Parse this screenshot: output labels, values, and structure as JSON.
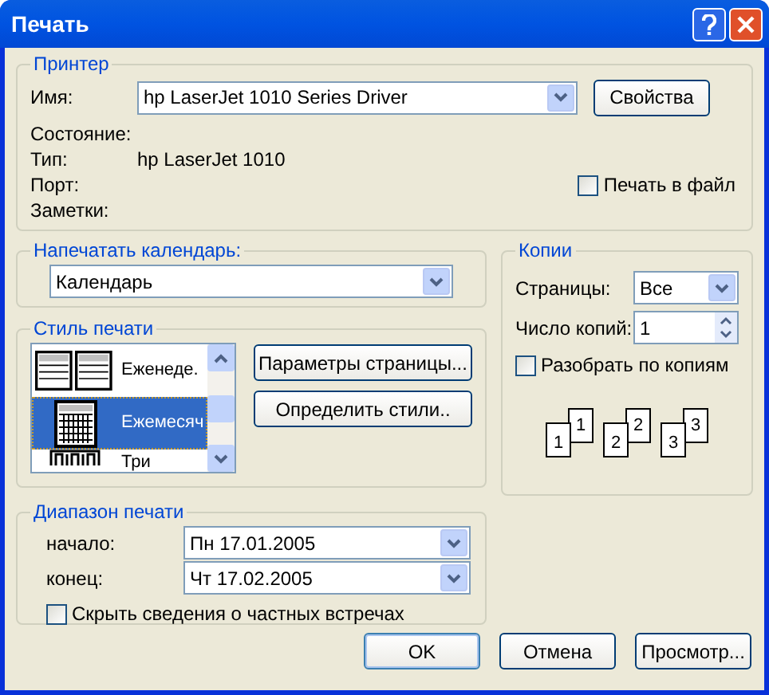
{
  "window": {
    "title": "Печать"
  },
  "printer": {
    "title": "Принтер",
    "name_label": "Имя:",
    "name_value": "hp LaserJet 1010 Series Driver",
    "properties_button": "Свойства",
    "status_label": "Состояние:",
    "type_label": "Тип:",
    "type_value": "hp LaserJet 1010",
    "port_label": "Порт:",
    "notes_label": "Заметки:",
    "print_to_file": {
      "label": "Печать в файл",
      "checked": false
    }
  },
  "calendar": {
    "title": "Напечатать календарь:",
    "value": "Календарь"
  },
  "print_style": {
    "title": "Стиль печати",
    "items": [
      {
        "kind": "weekly",
        "label": "Еженеде.",
        "selected": false
      },
      {
        "kind": "monthly",
        "label": "Ежемесяч",
        "selected": true
      },
      {
        "kind": "trifold",
        "label": "Три",
        "selected": false
      }
    ],
    "buttons": [
      "Параметры страницы...",
      "Определить стили.."
    ]
  },
  "range": {
    "title": "Диапазон печати",
    "start_label": "начало:",
    "start_value": "Пн 17.01.2005",
    "end_label": "конец:",
    "end_value": "Чт 17.02.2005",
    "hide_private": {
      "label": "Скрыть сведения о частных встречах",
      "checked": false
    }
  },
  "copies": {
    "title": "Копии",
    "pages_label": "Страницы:",
    "pages_value": "Все",
    "count_label": "Число копий:",
    "count_value": "1",
    "collate": {
      "label": "Разобрать по копиям",
      "checked": false
    },
    "stacks": [
      {
        "back": "1",
        "front": "1"
      },
      {
        "back": "2",
        "front": "2"
      },
      {
        "back": "3",
        "front": "3"
      }
    ]
  },
  "buttons": [
    "OK",
    "Отмена",
    "Просмотр..."
  ]
}
